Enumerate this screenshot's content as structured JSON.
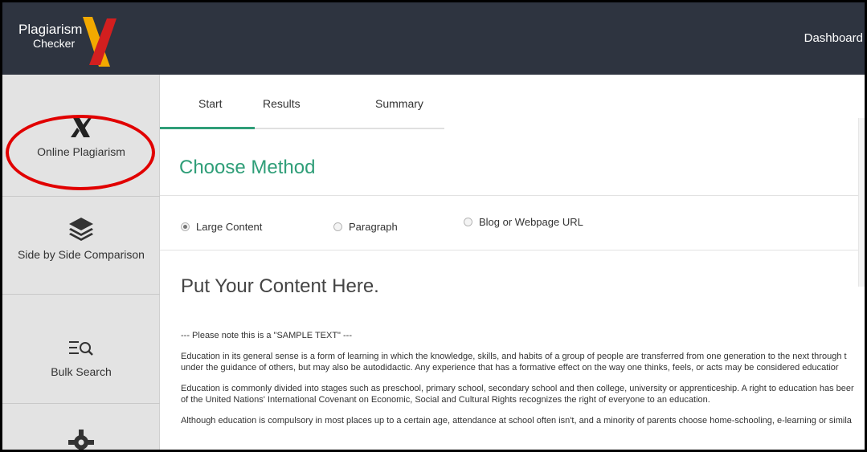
{
  "app": {
    "logo_line1": "Plagiarism",
    "logo_line2": "Checker",
    "logo_mark_icon": "x-logo-icon",
    "accent_color": "#2f9e78",
    "topbar_color": "#2e3440",
    "highlight_color": "#e10000"
  },
  "header": {
    "dashboard_label": "Dashboard"
  },
  "sidebar": {
    "items": [
      {
        "label": "Online Plagiarism",
        "icon": "x-icon"
      },
      {
        "label": "Side by Side Comparison",
        "icon": "layers-icon"
      },
      {
        "label": "Bulk Search",
        "icon": "list-search-icon"
      },
      {
        "label": "",
        "icon": "gear-icon"
      }
    ]
  },
  "tabs": [
    {
      "label": "Start",
      "active": true
    },
    {
      "label": "Results",
      "active": false
    },
    {
      "label": "Summary",
      "active": false
    }
  ],
  "method": {
    "title": "Choose Method",
    "options": [
      {
        "label": "Large Content",
        "selected": true
      },
      {
        "label": "Paragraph",
        "selected": false
      },
      {
        "label": "Blog or Webpage URL",
        "selected": false
      }
    ]
  },
  "content": {
    "title": "Put Your Content Here.",
    "note": "--- Please note this is a \"SAMPLE TEXT\" ---",
    "para1_line1": "Education in its general sense is a form of learning in which the knowledge, skills, and habits of a group of people are transferred from one generation to the next through t",
    "para1_line2": "under the guidance of others, but may also be autodidactic. Any experience that has a formative effect on the way one thinks, feels, or acts may be considered educatior",
    "para2_line1": "Education is commonly divided into stages such as preschool, primary school, secondary school and then college, university or apprenticeship. A right to education has beer",
    "para2_line2": "of the United Nations' International Covenant on Economic, Social and Cultural Rights recognizes the right of everyone to an education.",
    "para3_line1": "Although education is compulsory in most places up to a certain age, attendance at school often isn't, and a minority of parents choose home-schooling, e-learning or simila"
  }
}
